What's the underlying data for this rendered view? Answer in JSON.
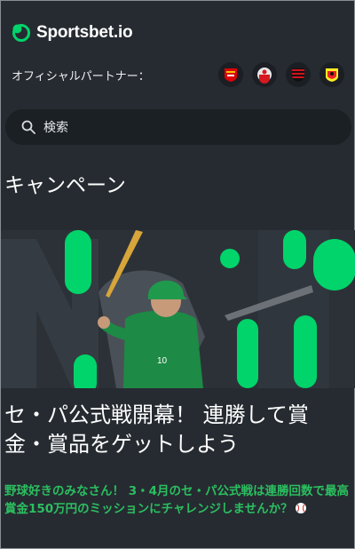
{
  "brand": {
    "name": "Sportsbet.io",
    "accent": "#00d46a"
  },
  "partners": {
    "label": "オフィシャルパートナー：",
    "badges": [
      "arsenal-crest-icon",
      "southampton-crest-icon",
      "flamengo-crest-icon",
      "watford-crest-icon"
    ]
  },
  "search": {
    "placeholder": "検索",
    "icon": "search-icon"
  },
  "section": {
    "title": "キャンペーン"
  },
  "promo": {
    "title": "セ・パ公式戦開幕！ 連勝して賞金・賞品をゲットしよう",
    "description": "野球好きのみなさん！ 3・4月のセ・パ公式戦は連勝回数で最高賞金150万円のミッションにチャレンジしませんか？",
    "description_icon": "baseball-icon"
  },
  "colors": {
    "background": "#262b31",
    "search_bg": "#1b2025",
    "promo_text_green": "#2bbf60"
  }
}
